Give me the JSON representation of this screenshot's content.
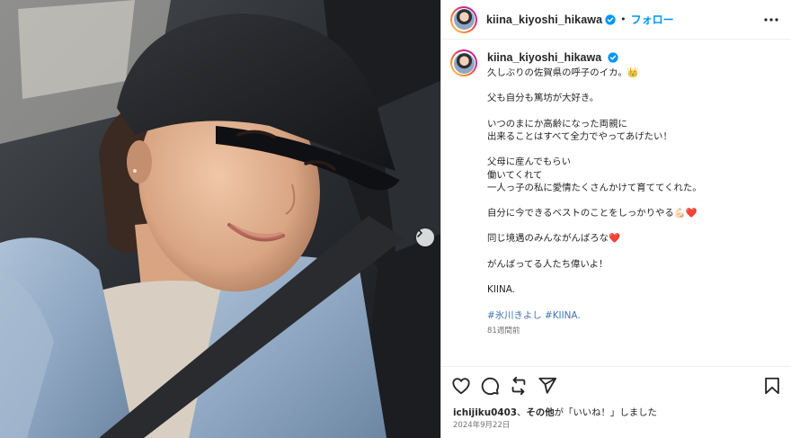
{
  "post": {
    "username": "kiina_kiyoshi_hikawa",
    "follow_label": "フォロー",
    "separator": "•",
    "caption_lines": [
      "久しぶりの佐賀県の呼子のイカ。👑",
      "",
      "父も自分も篤坊が大好き。",
      "",
      "いつのまにか高齢になった両親に",
      "出来ることはすべて全力でやってあげたい！",
      "",
      "父母に産んでもらい",
      "働いてくれて",
      "一人っ子の私に愛情たくさんかけて育ててくれた。",
      "",
      "自分に今できるベストのことをしっかりやる💪🏻❤️",
      "",
      "同じ境遇のみんながんばろな❤️",
      "",
      "がんばってる人たち偉いよ！",
      "",
      "KIINA."
    ],
    "hashtags": [
      "#氷川きよし",
      "#KIINA."
    ],
    "time_ago": "81週間前",
    "liked_by_user": "ichijiku0403",
    "liked_by_rest": "、",
    "liked_by_others": "その他",
    "liked_suffix": "が「いいね！」しました",
    "date": "2024年9月22日"
  },
  "icons": {
    "verified": "verified-badge-icon",
    "more": "more-options-icon",
    "like": "heart-icon",
    "comment": "comment-icon",
    "share": "repost-icon",
    "send": "send-icon",
    "save": "bookmark-icon",
    "next": "chevron-right-icon"
  },
  "colors": {
    "accent": "#0095f6",
    "verified": "#0095f6",
    "hashtag": "#3f72af"
  }
}
